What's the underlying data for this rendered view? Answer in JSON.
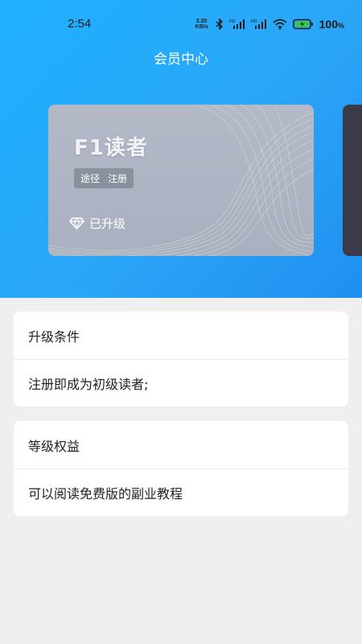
{
  "status_bar": {
    "time": "2:54",
    "net_speed_value": "2.20",
    "net_speed_unit": "KB/s",
    "battery_percent": "100",
    "battery_unit": "%",
    "icons": [
      "bluetooth-icon",
      "hd-signal-icon",
      "hd-signal-icon",
      "wifi-icon",
      "battery-charging-icon"
    ]
  },
  "header": {
    "title": "会员中心"
  },
  "member_card": {
    "level_name": "F1读者",
    "tag_label": "途径",
    "tag_value": "注册",
    "status_icon": "diamond-icon",
    "status_text": "已升级"
  },
  "sections": [
    {
      "title": "升级条件",
      "content": "注册即成为初级读者;"
    },
    {
      "title": "等级权益",
      "content": "可以阅读免费版的副业教程"
    }
  ],
  "colors": {
    "header_gradient_start": "#1fb0ff",
    "header_gradient_end": "#1f8ff0",
    "card_background": "#b0b6c4",
    "next_card_background": "#3a3a48",
    "page_background": "#efefef"
  }
}
